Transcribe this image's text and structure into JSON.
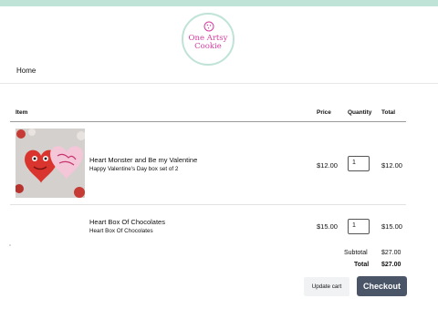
{
  "brand": {
    "line1": "One Artsy",
    "line2": "Cookie"
  },
  "nav": {
    "home": "Home"
  },
  "table": {
    "headers": {
      "item": "Item",
      "price": "Price",
      "quantity": "Quantity",
      "total": "Total"
    },
    "rows": [
      {
        "name": "Heart Monster and Be my Valentine",
        "variant": "Happy Valentine's Day box set of 2",
        "price": "$12.00",
        "quantity": "1",
        "total": "$12.00",
        "image": "cookie-photo"
      },
      {
        "name": "Heart Box Of Chocolates",
        "variant": "Heart Box Of Chocolates",
        "price": "$15.00",
        "quantity": "1",
        "total": "$15.00"
      }
    ]
  },
  "summary": {
    "subtotal_label": "Subtotal",
    "subtotal_value": "$27.00",
    "total_label": "Total",
    "total_value": "$27.00"
  },
  "actions": {
    "update": "Update cart",
    "checkout": "Checkout"
  },
  "colors": {
    "accent_bar": "#bfe3d6",
    "logo_text": "#d63ca0",
    "checkout_bg": "#4a5567",
    "update_bg": "#f1f2f4"
  }
}
